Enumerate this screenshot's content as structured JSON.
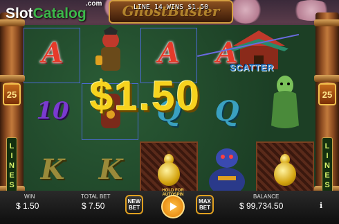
{
  "watermark": {
    "brand_part1": "Slot",
    "brand_part2": "Catalog",
    "suffix": ".com"
  },
  "game": {
    "title": "GhostBuster",
    "line_info": "LINE 14 WINS $1.50",
    "big_win": "$1.50"
  },
  "reels": {
    "row1": [
      "A",
      "character",
      "A",
      "A",
      "scatter"
    ],
    "row2": [
      "10",
      "character",
      "Q",
      "Q",
      "character"
    ],
    "row3": [
      "K",
      "K",
      "gourd",
      "character",
      "gourd"
    ],
    "scatter_label": "SCATTER"
  },
  "side": {
    "lines_count_left": "25",
    "lines_count_right": "25",
    "lines_label": [
      "L",
      "I",
      "N",
      "E",
      "S"
    ]
  },
  "bottom": {
    "win_label": "WIN",
    "win_value": "$ 1.50",
    "total_bet_label": "TOTAL BET",
    "total_bet_value": "$ 7.50",
    "new_bet_label": "NEW BET",
    "autospin_hint": "HOLD FOR AUTOSPIN",
    "max_bet_label": "MAX BET",
    "balance_label": "BALANCE",
    "balance_value": "$ 99,734.50",
    "info_glyph": "i"
  },
  "colors": {
    "accent_gold": "#f7d31e",
    "reel_green": "#1f4a2c",
    "button_border": "#e0a020"
  }
}
